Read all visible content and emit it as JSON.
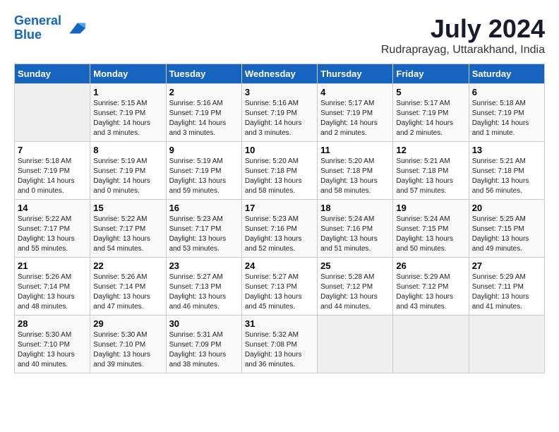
{
  "logo": {
    "line1": "General",
    "line2": "Blue"
  },
  "title": "July 2024",
  "location": "Rudraprayag, Uttarakhand, India",
  "headers": [
    "Sunday",
    "Monday",
    "Tuesday",
    "Wednesday",
    "Thursday",
    "Friday",
    "Saturday"
  ],
  "weeks": [
    [
      {
        "day": "",
        "sunrise": "",
        "sunset": "",
        "daylight": ""
      },
      {
        "day": "1",
        "sunrise": "Sunrise: 5:15 AM",
        "sunset": "Sunset: 7:19 PM",
        "daylight": "Daylight: 14 hours and 3 minutes."
      },
      {
        "day": "2",
        "sunrise": "Sunrise: 5:16 AM",
        "sunset": "Sunset: 7:19 PM",
        "daylight": "Daylight: 14 hours and 3 minutes."
      },
      {
        "day": "3",
        "sunrise": "Sunrise: 5:16 AM",
        "sunset": "Sunset: 7:19 PM",
        "daylight": "Daylight: 14 hours and 3 minutes."
      },
      {
        "day": "4",
        "sunrise": "Sunrise: 5:17 AM",
        "sunset": "Sunset: 7:19 PM",
        "daylight": "Daylight: 14 hours and 2 minutes."
      },
      {
        "day": "5",
        "sunrise": "Sunrise: 5:17 AM",
        "sunset": "Sunset: 7:19 PM",
        "daylight": "Daylight: 14 hours and 2 minutes."
      },
      {
        "day": "6",
        "sunrise": "Sunrise: 5:18 AM",
        "sunset": "Sunset: 7:19 PM",
        "daylight": "Daylight: 14 hours and 1 minute."
      }
    ],
    [
      {
        "day": "7",
        "sunrise": "Sunrise: 5:18 AM",
        "sunset": "Sunset: 7:19 PM",
        "daylight": "Daylight: 14 hours and 0 minutes."
      },
      {
        "day": "8",
        "sunrise": "Sunrise: 5:19 AM",
        "sunset": "Sunset: 7:19 PM",
        "daylight": "Daylight: 14 hours and 0 minutes."
      },
      {
        "day": "9",
        "sunrise": "Sunrise: 5:19 AM",
        "sunset": "Sunset: 7:19 PM",
        "daylight": "Daylight: 13 hours and 59 minutes."
      },
      {
        "day": "10",
        "sunrise": "Sunrise: 5:20 AM",
        "sunset": "Sunset: 7:18 PM",
        "daylight": "Daylight: 13 hours and 58 minutes."
      },
      {
        "day": "11",
        "sunrise": "Sunrise: 5:20 AM",
        "sunset": "Sunset: 7:18 PM",
        "daylight": "Daylight: 13 hours and 58 minutes."
      },
      {
        "day": "12",
        "sunrise": "Sunrise: 5:21 AM",
        "sunset": "Sunset: 7:18 PM",
        "daylight": "Daylight: 13 hours and 57 minutes."
      },
      {
        "day": "13",
        "sunrise": "Sunrise: 5:21 AM",
        "sunset": "Sunset: 7:18 PM",
        "daylight": "Daylight: 13 hours and 56 minutes."
      }
    ],
    [
      {
        "day": "14",
        "sunrise": "Sunrise: 5:22 AM",
        "sunset": "Sunset: 7:17 PM",
        "daylight": "Daylight: 13 hours and 55 minutes."
      },
      {
        "day": "15",
        "sunrise": "Sunrise: 5:22 AM",
        "sunset": "Sunset: 7:17 PM",
        "daylight": "Daylight: 13 hours and 54 minutes."
      },
      {
        "day": "16",
        "sunrise": "Sunrise: 5:23 AM",
        "sunset": "Sunset: 7:17 PM",
        "daylight": "Daylight: 13 hours and 53 minutes."
      },
      {
        "day": "17",
        "sunrise": "Sunrise: 5:23 AM",
        "sunset": "Sunset: 7:16 PM",
        "daylight": "Daylight: 13 hours and 52 minutes."
      },
      {
        "day": "18",
        "sunrise": "Sunrise: 5:24 AM",
        "sunset": "Sunset: 7:16 PM",
        "daylight": "Daylight: 13 hours and 51 minutes."
      },
      {
        "day": "19",
        "sunrise": "Sunrise: 5:24 AM",
        "sunset": "Sunset: 7:15 PM",
        "daylight": "Daylight: 13 hours and 50 minutes."
      },
      {
        "day": "20",
        "sunrise": "Sunrise: 5:25 AM",
        "sunset": "Sunset: 7:15 PM",
        "daylight": "Daylight: 13 hours and 49 minutes."
      }
    ],
    [
      {
        "day": "21",
        "sunrise": "Sunrise: 5:26 AM",
        "sunset": "Sunset: 7:14 PM",
        "daylight": "Daylight: 13 hours and 48 minutes."
      },
      {
        "day": "22",
        "sunrise": "Sunrise: 5:26 AM",
        "sunset": "Sunset: 7:14 PM",
        "daylight": "Daylight: 13 hours and 47 minutes."
      },
      {
        "day": "23",
        "sunrise": "Sunrise: 5:27 AM",
        "sunset": "Sunset: 7:13 PM",
        "daylight": "Daylight: 13 hours and 46 minutes."
      },
      {
        "day": "24",
        "sunrise": "Sunrise: 5:27 AM",
        "sunset": "Sunset: 7:13 PM",
        "daylight": "Daylight: 13 hours and 45 minutes."
      },
      {
        "day": "25",
        "sunrise": "Sunrise: 5:28 AM",
        "sunset": "Sunset: 7:12 PM",
        "daylight": "Daylight: 13 hours and 44 minutes."
      },
      {
        "day": "26",
        "sunrise": "Sunrise: 5:29 AM",
        "sunset": "Sunset: 7:12 PM",
        "daylight": "Daylight: 13 hours and 43 minutes."
      },
      {
        "day": "27",
        "sunrise": "Sunrise: 5:29 AM",
        "sunset": "Sunset: 7:11 PM",
        "daylight": "Daylight: 13 hours and 41 minutes."
      }
    ],
    [
      {
        "day": "28",
        "sunrise": "Sunrise: 5:30 AM",
        "sunset": "Sunset: 7:10 PM",
        "daylight": "Daylight: 13 hours and 40 minutes."
      },
      {
        "day": "29",
        "sunrise": "Sunrise: 5:30 AM",
        "sunset": "Sunset: 7:10 PM",
        "daylight": "Daylight: 13 hours and 39 minutes."
      },
      {
        "day": "30",
        "sunrise": "Sunrise: 5:31 AM",
        "sunset": "Sunset: 7:09 PM",
        "daylight": "Daylight: 13 hours and 38 minutes."
      },
      {
        "day": "31",
        "sunrise": "Sunrise: 5:32 AM",
        "sunset": "Sunset: 7:08 PM",
        "daylight": "Daylight: 13 hours and 36 minutes."
      },
      {
        "day": "",
        "sunrise": "",
        "sunset": "",
        "daylight": ""
      },
      {
        "day": "",
        "sunrise": "",
        "sunset": "",
        "daylight": ""
      },
      {
        "day": "",
        "sunrise": "",
        "sunset": "",
        "daylight": ""
      }
    ]
  ]
}
